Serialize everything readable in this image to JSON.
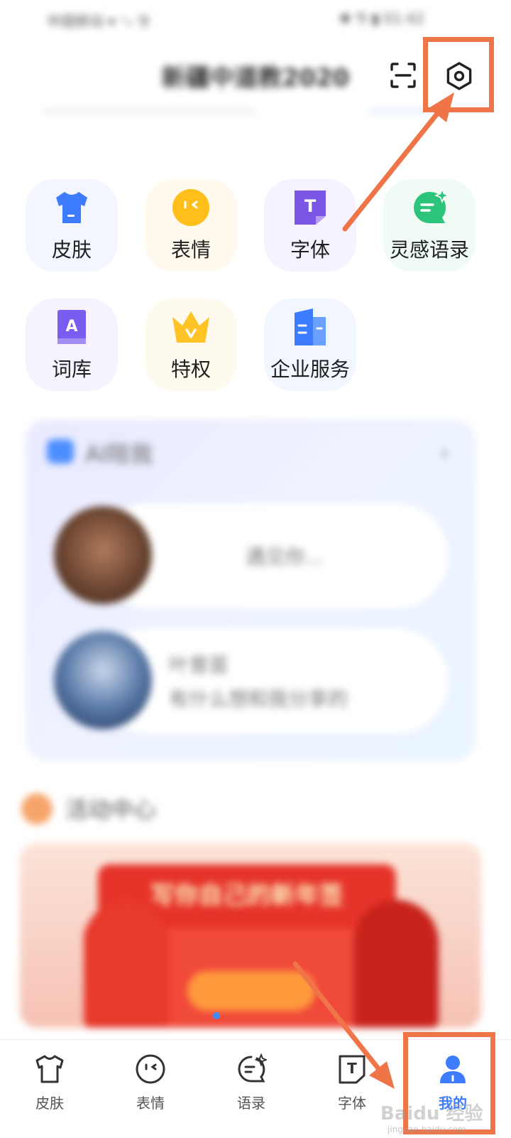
{
  "status_bar": {
    "left": "中国移动 ▾ ⁺ᵢₗ 令",
    "right": "✱ ⅋ ▮ 01:42"
  },
  "profile": {
    "username": "新疆中道教2020"
  },
  "header_icons": {
    "scan": "scan-icon",
    "settings": "settings-icon"
  },
  "features": [
    {
      "label": "皮肤",
      "icon": "tshirt-icon",
      "color": "#3d7bff"
    },
    {
      "label": "表情",
      "icon": "emoji-icon",
      "color": "#ffbe1a"
    },
    {
      "label": "字体",
      "icon": "font-icon",
      "color": "#7a55e6"
    },
    {
      "label": "灵感语录",
      "icon": "quote-bubble-icon",
      "color": "#2cc37a"
    },
    {
      "label": "词库",
      "icon": "lexicon-icon",
      "color": "#7b5cf0"
    },
    {
      "label": "特权",
      "icon": "crown-icon",
      "color": "#ffc326"
    },
    {
      "label": "企业服务",
      "icon": "enterprise-icon",
      "color": "#3d7bff"
    }
  ],
  "ai_section": {
    "title": "AI陪我",
    "chats": [
      {
        "name": "",
        "message": "遇见你..."
      },
      {
        "name": "叶曾苗",
        "message": "有什么想和我分享的"
      }
    ]
  },
  "activity_section": {
    "title": "活动中心",
    "banner_title": "写你自己的新年签"
  },
  "tabbar": {
    "tabs": [
      {
        "label": "皮肤",
        "icon": "tshirt-outline-icon",
        "active": false
      },
      {
        "label": "表情",
        "icon": "smile-outline-icon",
        "active": false
      },
      {
        "label": "语录",
        "icon": "quote-outline-icon",
        "active": false
      },
      {
        "label": "字体",
        "icon": "font-outline-icon",
        "active": false
      },
      {
        "label": "我的",
        "icon": "profile-icon",
        "active": true
      }
    ],
    "active_color": "#3d7bff"
  },
  "watermark": {
    "text": "Baidu 经验",
    "url_text": "jingyan.baidu.com"
  },
  "annotation": {
    "highlight_color": "#ef7447"
  }
}
